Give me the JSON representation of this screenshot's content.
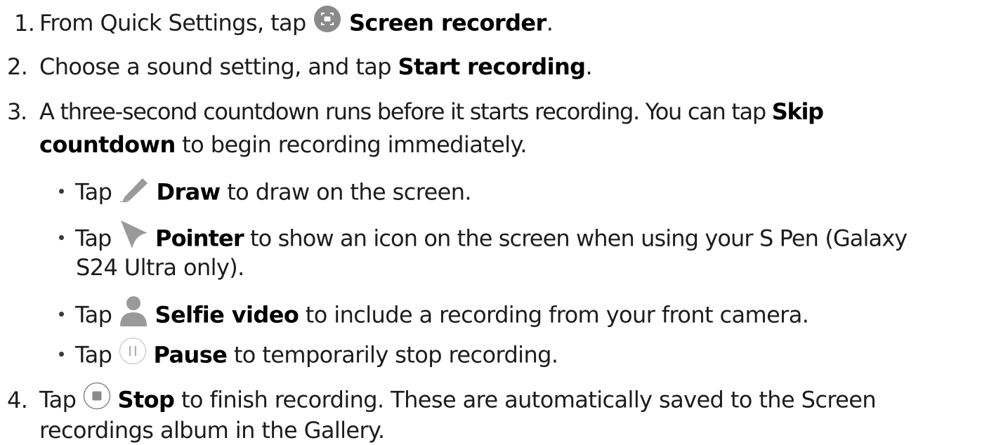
{
  "steps": {
    "s1": {
      "num": "1.",
      "t1": "From Quick Settings, tap",
      "b1": "Screen recorder",
      "t2": "."
    },
    "s2": {
      "num": "2.",
      "t1": "Choose a sound setting, and tap",
      "b1": "Start recording",
      "t2": "."
    },
    "s3": {
      "num": "3.",
      "t1": "A three-second countdown runs before it starts recording. You can tap",
      "b1": "Skip",
      "b2": "countdown",
      "t2": "to begin recording immediately."
    },
    "s4": {
      "num": "4.",
      "t0": "Tap",
      "b1": "Stop",
      "t1": "to finish recording. These are automatically saved to the Screen",
      "t2": "recordings album in the Gallery."
    }
  },
  "bullets": [
    {
      "tap": "Tap",
      "icon": "pencil-icon",
      "bold": "Draw",
      "text": "to draw on the screen."
    },
    {
      "tap": "Tap",
      "icon": "pointer-icon",
      "bold": "Pointer",
      "text": "to show an icon on the screen when using your S Pen (Galaxy",
      "text2": "S24 Ultra only)."
    },
    {
      "tap": "Tap",
      "icon": "person-icon",
      "bold": "Selfie video",
      "text": "to include a recording from your front camera."
    },
    {
      "tap": "Tap",
      "icon": "pause-icon",
      "bold": "Pause",
      "text": "to temporarily stop recording."
    }
  ],
  "icons": {
    "screen_recorder": "screen-recorder-icon",
    "stop": "stop-icon"
  },
  "colors": {
    "text": "#1c1c1c",
    "bold": "#000000",
    "icon_gray": "#8a8a8a",
    "icon_light": "#bdbdbd"
  }
}
